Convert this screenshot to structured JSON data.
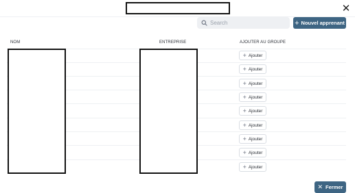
{
  "modal": {
    "close_icon": "close-icon"
  },
  "toolbar": {
    "search_placeholder": "Search",
    "new_button_label": "Nouvel apprenant"
  },
  "table": {
    "columns": [
      "NOM",
      "ENTREPRISE",
      "AJOUTER AU GROUPE"
    ],
    "rows": [
      {
        "action": "Ajouter"
      },
      {
        "action": "Ajouter"
      },
      {
        "action": "Ajouter"
      },
      {
        "action": "Ajouter"
      },
      {
        "action": "Ajouter"
      },
      {
        "action": "Ajouter"
      },
      {
        "action": "Ajouter"
      },
      {
        "action": "Ajouter"
      },
      {
        "action": "Ajouter"
      }
    ]
  },
  "footer": {
    "close_label": "Fermer"
  },
  "colors": {
    "primary": "#3e6583",
    "search_bg": "#eef0f3",
    "border": "#d9dde3"
  }
}
